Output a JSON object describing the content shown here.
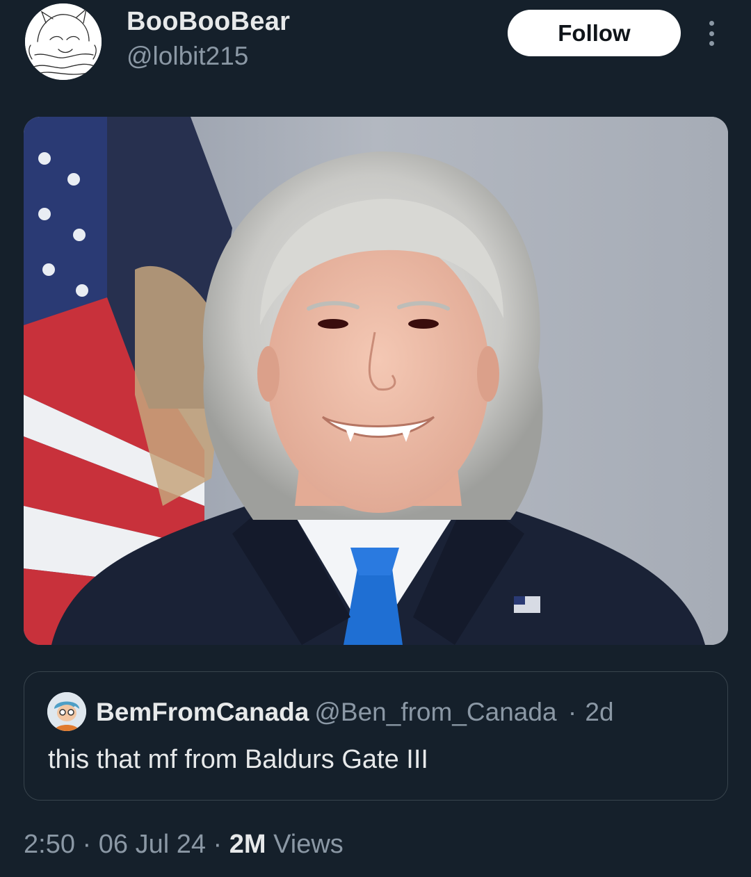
{
  "author": {
    "display_name": "BooBooBear",
    "handle": "@lolbit215"
  },
  "actions": {
    "follow_label": "Follow",
    "more_icon": "more-vertical-icon"
  },
  "media": {
    "type": "photo"
  },
  "quoted_tweet": {
    "display_name": "BemFromCanada",
    "handle": "@Ben_from_Canada",
    "separator": "·",
    "age": "2d",
    "text": "this that mf from Baldurs Gate III"
  },
  "meta": {
    "time": "2:50",
    "date": "06 Jul 24",
    "separator": "·",
    "views_count": "2M",
    "views_label": "Views"
  },
  "colors": {
    "background": "#15202b",
    "primary_text": "#e7e9ea",
    "secondary_text": "#8b98a5",
    "border": "#38444d",
    "follow_bg": "#ffffff",
    "follow_text": "#0f1419"
  }
}
